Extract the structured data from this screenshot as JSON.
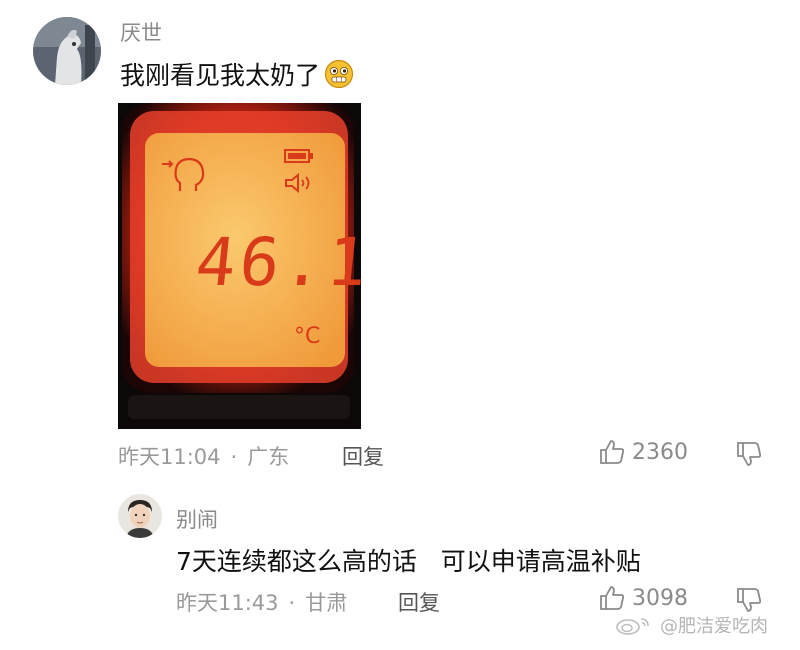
{
  "comments": [
    {
      "username": "厌世",
      "text": "我刚看见我太奶了",
      "emoji": "grinning-face-icon",
      "time": "昨天11:04",
      "location": "广东",
      "separator": "·",
      "reply_label": "回复",
      "likes": "2360",
      "image": {
        "screen_reading": "46.1",
        "unit": "°C"
      }
    },
    {
      "username": "别闹",
      "text": "7天连续都这么高的话   可以申请高温补贴",
      "time": "昨天11:43",
      "location": "甘肃",
      "separator": "·",
      "reply_label": "回复",
      "likes": "3098"
    }
  ],
  "watermark": "@肥洁爱吃肉",
  "colors": {
    "display_orange": "#f6ae4c",
    "display_frame": "#e8402a",
    "digit_red": "#d93a1a"
  }
}
